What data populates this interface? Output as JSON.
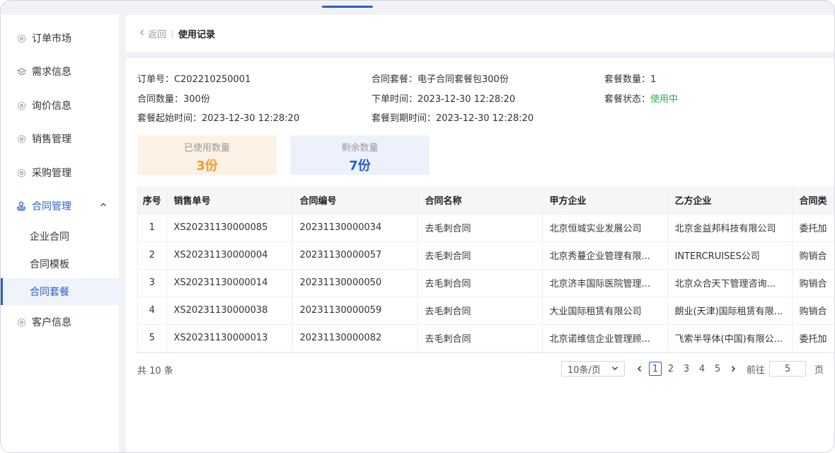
{
  "sidebar": {
    "items": [
      {
        "label": "订单市场",
        "icon": "gear-icon"
      },
      {
        "label": "需求信息",
        "icon": "layers-icon"
      },
      {
        "label": "询价信息",
        "icon": "gear-icon"
      },
      {
        "label": "销售管理",
        "icon": "gear-icon"
      },
      {
        "label": "采购管理",
        "icon": "gear-icon"
      },
      {
        "label": "合同管理",
        "icon": "stamp-icon"
      },
      {
        "label": "客户信息",
        "icon": "gear-icon"
      }
    ],
    "subitems": [
      {
        "label": "企业合同"
      },
      {
        "label": "合同模板"
      },
      {
        "label": "合同套餐"
      }
    ]
  },
  "header": {
    "back_label": "返回",
    "title": "使用记录"
  },
  "info": {
    "order_no_label": "订单号：",
    "order_no": "C202210250001",
    "package_label": "合同套餐：",
    "package": "电子合同套餐包300份",
    "package_count_label": "套餐数量：",
    "package_count": "1",
    "contract_count_label": "合同数量：",
    "contract_count": "300份",
    "order_time_label": "下单时间：",
    "order_time": "2023-12-30 12:28:20",
    "status_label": "套餐状态：",
    "status": "使用中",
    "start_time_label": "套餐起始时间：",
    "start_time": "2023-12-30 12:28:20",
    "end_time_label": "套餐到期时间：",
    "end_time": "2023-12-30 12:28:20"
  },
  "stats": {
    "used_label": "已使用数量",
    "used_value": "3份",
    "remaining_label": "剩余数量",
    "remaining_value": "7份"
  },
  "table": {
    "headers": [
      "序号",
      "销售单号",
      "合同编号",
      "合同名称",
      "甲方企业",
      "乙方企业",
      "合同类"
    ],
    "rows": [
      [
        "1",
        "XS20231130000085",
        "20231130000034",
        "去毛刺合同",
        "北京恒城实业发展公司",
        "北京金益邦科技有限公司",
        "委托加"
      ],
      [
        "2",
        "XS20231130000004",
        "20231130000057",
        "去毛刺合同",
        "北京秀蔓企业管理有限...",
        "INTERCRUISES公司",
        "购销合"
      ],
      [
        "3",
        "XS20231130000014",
        "20231130000050",
        "去毛刺合同",
        "北京济丰国际医院管理...",
        "北京众合天下管理咨询...",
        "购销合"
      ],
      [
        "4",
        "XS20231130000038",
        "20231130000059",
        "去毛刺合同",
        "大业国际租赁有限公司",
        "朗业(天津)国际租赁有限...",
        "购销合"
      ],
      [
        "5",
        "XS20231130000013",
        "20231130000082",
        "去毛刺合同",
        "北京诺维信企业管理顾...",
        "飞索半导体(中国)有限公...",
        "委托加"
      ]
    ]
  },
  "pagination": {
    "total": "共 10 条",
    "page_size": "10条/页",
    "pages": [
      "1",
      "2",
      "3",
      "4",
      "5"
    ],
    "current": "1",
    "goto_label": "前往",
    "goto_value": "5",
    "page_suffix": "页"
  },
  "colors": {
    "accent": "#2b5fc4",
    "status_green": "#2bb24c",
    "used_orange": "#f59a23"
  }
}
